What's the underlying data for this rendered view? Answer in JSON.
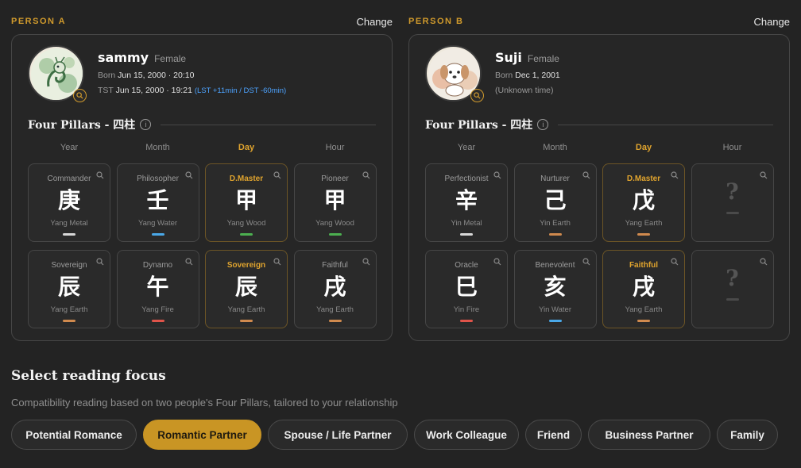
{
  "change_label": "Change",
  "fp_title": "Four Pillars - 四柱",
  "columns": [
    "Year",
    "Month",
    "Day",
    "Hour"
  ],
  "persons": [
    {
      "tag": "PERSON A",
      "name": "sammy",
      "gender": "Female",
      "born_label": "Born",
      "born_value": "Jun 15, 2000 · 20:10",
      "tst_label": "TST",
      "tst_value": "Jun 15, 2000 · 19:21",
      "tst_adjust": "(LST +11min / DST -60min)",
      "avatar": "dragon-illustration",
      "pillars": [
        {
          "role": "Commander",
          "glyph": "庚",
          "elem": "Yang Metal",
          "color": "#d8d8d8"
        },
        {
          "role": "Philosopher",
          "glyph": "壬",
          "elem": "Yang Water",
          "color": "#4aa8e8"
        },
        {
          "role": "D.Master",
          "glyph": "甲",
          "elem": "Yang Wood",
          "color": "#4caf50"
        },
        {
          "role": "Pioneer",
          "glyph": "甲",
          "elem": "Yang Wood",
          "color": "#4caf50"
        },
        {
          "role": "Sovereign",
          "glyph": "辰",
          "elem": "Yang Earth",
          "color": "#d08a4e"
        },
        {
          "role": "Dynamo",
          "glyph": "午",
          "elem": "Yang Fire",
          "color": "#e0544a"
        },
        {
          "role": "Sovereign",
          "glyph": "辰",
          "elem": "Yang Earth",
          "color": "#d08a4e"
        },
        {
          "role": "Faithful",
          "glyph": "戌",
          "elem": "Yang Earth",
          "color": "#d08a4e"
        }
      ]
    },
    {
      "tag": "PERSON B",
      "name": "Suji",
      "gender": "Female",
      "born_label": "Born",
      "born_value": "Dec 1, 2001",
      "tst_value": "(Unknown time)",
      "avatar": "puppy-illustration",
      "pillars": [
        {
          "role": "Perfectionist",
          "glyph": "辛",
          "elem": "Yin Metal",
          "color": "#d8d8d8"
        },
        {
          "role": "Nurturer",
          "glyph": "己",
          "elem": "Yin Earth",
          "color": "#d08a4e"
        },
        {
          "role": "D.Master",
          "glyph": "戊",
          "elem": "Yang Earth",
          "color": "#d08a4e"
        },
        {
          "role": "",
          "glyph": "?",
          "elem": "",
          "color": "#4a4a4a"
        },
        {
          "role": "Oracle",
          "glyph": "巳",
          "elem": "Yin Fire",
          "color": "#e0544a"
        },
        {
          "role": "Benevolent",
          "glyph": "亥",
          "elem": "Yin Water",
          "color": "#4aa8e8"
        },
        {
          "role": "Faithful",
          "glyph": "戌",
          "elem": "Yang Earth",
          "color": "#d08a4e"
        },
        {
          "role": "",
          "glyph": "?",
          "elem": "",
          "color": "#4a4a4a"
        }
      ]
    }
  ],
  "focus": {
    "title": "Select reading focus",
    "subtitle": "Compatibility reading based on two people's Four Pillars, tailored to your relationship",
    "chips": [
      "Potential Romance",
      "Romantic Partner",
      "Spouse / Life Partner",
      "Work Colleague",
      "Friend",
      "Business Partner",
      "Family"
    ],
    "selected": "Romantic Partner"
  },
  "colors": {
    "accent": "#c99524",
    "day_label": "#e0a42e"
  }
}
